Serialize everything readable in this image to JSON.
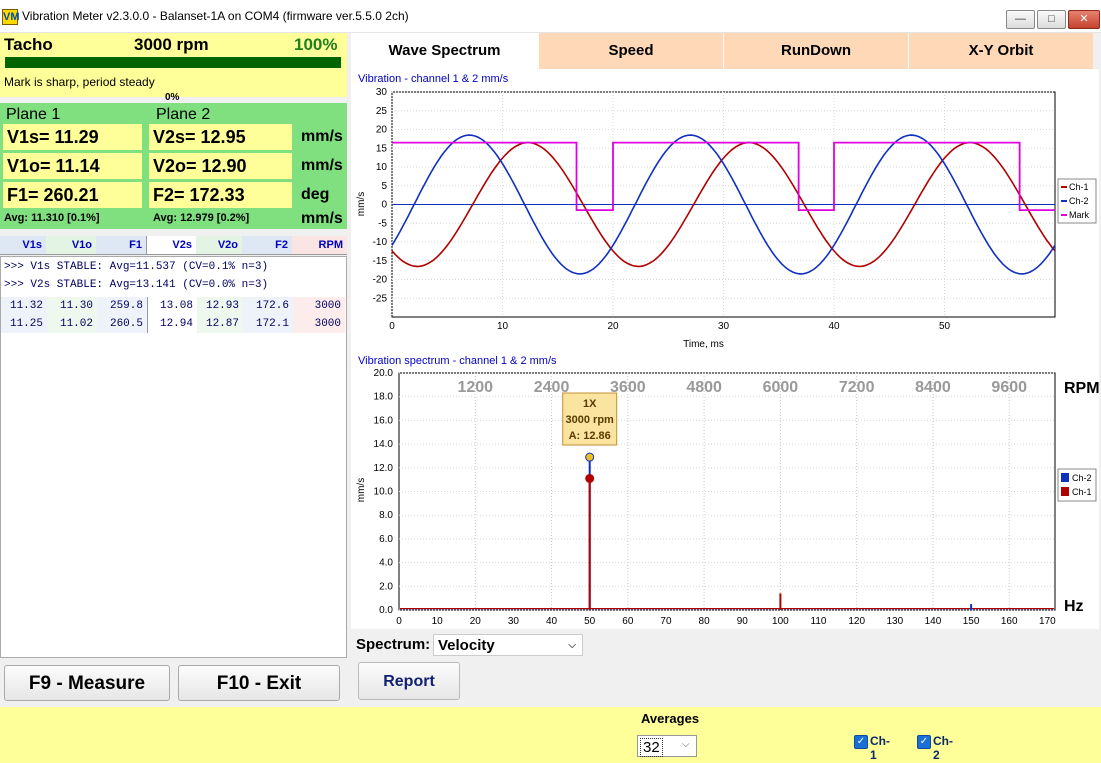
{
  "window": {
    "title": "Vibration Meter v2.3.0.0 - Balanset-1A on COM4 (firmware ver.5.5.0 2ch)",
    "icon": "VM"
  },
  "tacho": {
    "label": "Tacho",
    "rpm": "3000 rpm",
    "percent": "100%",
    "status": "Mark is sharp, period steady",
    "bar_label": "0%",
    "bar_fill": 1.0
  },
  "plane1": {
    "title": "Plane 1",
    "v1s": "V1s= 11.29",
    "v1o": "V1o= 11.14",
    "f1": "F1= 260.21",
    "avg": "Avg: 11.310 [0.1%]"
  },
  "plane2": {
    "title": "Plane 2",
    "v2s": "V2s= 12.95",
    "v2o": "V2o= 12.90",
    "f2": "F2= 172.33",
    "avg": "Avg: 12.979 [0.2%]"
  },
  "units": {
    "u1": "mm/s",
    "u2": "mm/s",
    "u3": "deg",
    "u4": "mm/s"
  },
  "table": {
    "headers": [
      "V1s",
      "V1o",
      "F1",
      "V2s",
      "V2o",
      "F2",
      "RPM"
    ],
    "log": [
      ">>> V1s STABLE: Avg=11.537 (CV=0.1% n=3)",
      ">>> V2s STABLE: Avg=13.141 (CV=0.0% n=3)"
    ],
    "rows": [
      [
        "11.32",
        "11.30",
        "259.8",
        "13.08",
        "12.93",
        "172.6",
        "3000"
      ],
      [
        "11.25",
        "11.02",
        "260.5",
        "12.94",
        "12.87",
        "172.1",
        "3000"
      ]
    ]
  },
  "buttons": {
    "measure": "F9 - Measure",
    "exit": "F10 - Exit",
    "report": "Report"
  },
  "tabs": [
    "Wave Spectrum",
    "Speed",
    "RunDown",
    "X-Y Orbit"
  ],
  "spectrum_select": {
    "label": "Spectrum:",
    "value": "Velocity"
  },
  "averages": {
    "label": "Averages",
    "value": "32"
  },
  "checkboxes": [
    {
      "label": "Ch-1",
      "checked": true
    },
    {
      "label": "Ch-2",
      "checked": true
    }
  ],
  "colors": {
    "ch1": "#b00000",
    "ch2": "#1030c0",
    "mark": "#e000e0",
    "tab_bg": "#ffd8b8",
    "panel_yellow": "#ffff99",
    "panel_green": "#80e080"
  },
  "chart_data": [
    {
      "type": "line",
      "title": "Vibration  - channel 1 & 2 mm/s",
      "xlabel": "Time, ms",
      "ylabel": "mm/s",
      "xlim": [
        0,
        60
      ],
      "ylim": [
        -30,
        30
      ],
      "xticks": [
        0,
        10,
        20,
        30,
        40,
        50
      ],
      "yticks": [
        30,
        25,
        20,
        15,
        10,
        5,
        0,
        -5,
        -10,
        -15,
        -20,
        -25
      ],
      "legend": [
        "Ch-1",
        "Ch-2",
        "Mark"
      ],
      "legend_position": "right",
      "series": [
        {
          "name": "Ch-1",
          "color": "#b00000",
          "amplitude": 16.5,
          "period_ms": 20,
          "peak_ms": 12.3
        },
        {
          "name": "Ch-2",
          "color": "#1030c0",
          "amplitude": 18.5,
          "period_ms": 20,
          "peak_ms": 7.0
        },
        {
          "name": "Mark",
          "color": "#e000e0",
          "high": 16.5,
          "low": -1.5,
          "low_intervals_ms": [
            [
              16.7,
              20
            ],
            [
              36.8,
              40
            ],
            [
              56.8,
              60
            ]
          ]
        }
      ]
    },
    {
      "type": "line",
      "title": "Vibration spectrum  - channel 1 & 2 mm/s",
      "xlabel": "Hz",
      "ylabel": "mm/s",
      "secondary_xlabel": "RPM",
      "xlim": [
        0,
        172
      ],
      "ylim": [
        0,
        20
      ],
      "xticks": [
        0,
        10,
        20,
        30,
        40,
        50,
        60,
        70,
        80,
        90,
        100,
        110,
        120,
        130,
        140,
        150,
        160,
        170
      ],
      "yticks": [
        "20.0",
        "18.0",
        "16.0",
        "14.0",
        "12.0",
        "10.0",
        "8.0",
        "6.0",
        "4.0",
        "2.0",
        "0.0"
      ],
      "rpm_ticks": [
        "1200",
        "2400",
        "3600",
        "4800",
        "6000",
        "7200",
        "8400",
        "9600"
      ],
      "legend": [
        "Ch-2",
        "Ch-1"
      ],
      "legend_position": "right",
      "series": [
        {
          "name": "Ch-2",
          "color": "#1030c0",
          "peaks": [
            [
              50,
              12.9
            ],
            [
              150,
              0.5
            ]
          ]
        },
        {
          "name": "Ch-1",
          "color": "#b00000",
          "peaks": [
            [
              50,
              11.1
            ],
            [
              100,
              1.4
            ]
          ]
        }
      ],
      "annotation": {
        "lines": [
          "1X",
          "3000 rpm",
          "A: 12.86"
        ]
      }
    }
  ]
}
